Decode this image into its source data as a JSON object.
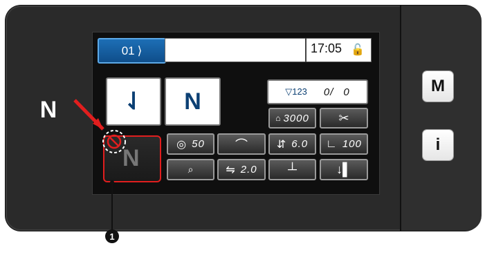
{
  "device": {
    "nfc_label": "N",
    "menu_button_label": "M",
    "info_button_label": "i"
  },
  "screen": {
    "pattern_tab_label": "01",
    "time": "17:05",
    "lock_icon": "unlock-icon",
    "counter": {
      "current": "0/",
      "total": "0"
    },
    "thread_tension": "3000",
    "presser_foot_value": "50",
    "stitch_length": "6.0",
    "feed_value": "100",
    "stitch_pitch": "2.0",
    "icons": {
      "pattern_main_1": "zigzag-down-arrow-icon",
      "pattern_main_2": "zigzag-icon",
      "counter_icon": "counter-icon",
      "thread_icon": "thread-tension-icon",
      "cut_icon": "scissors-icon",
      "presser_icon": "presser-foot-icon",
      "needle_icon": "needle-icon",
      "length_icon": "stitch-length-icon",
      "feed_icon": "feed-icon",
      "search_icon": "pattern-search-icon",
      "pitch_icon": "stitch-pitch-icon",
      "cross_icon": "cross-icon",
      "reverse_icon": "reverse-feed-icon",
      "disabled_icon": "prohibited-icon"
    }
  },
  "annotation": {
    "callout_label": "1"
  },
  "colors": {
    "screen_bg": "#0f0f0f",
    "button_blue": "#1d6fb6",
    "button_border": "#7ec0f2",
    "alert_red": "#e11e1e"
  }
}
